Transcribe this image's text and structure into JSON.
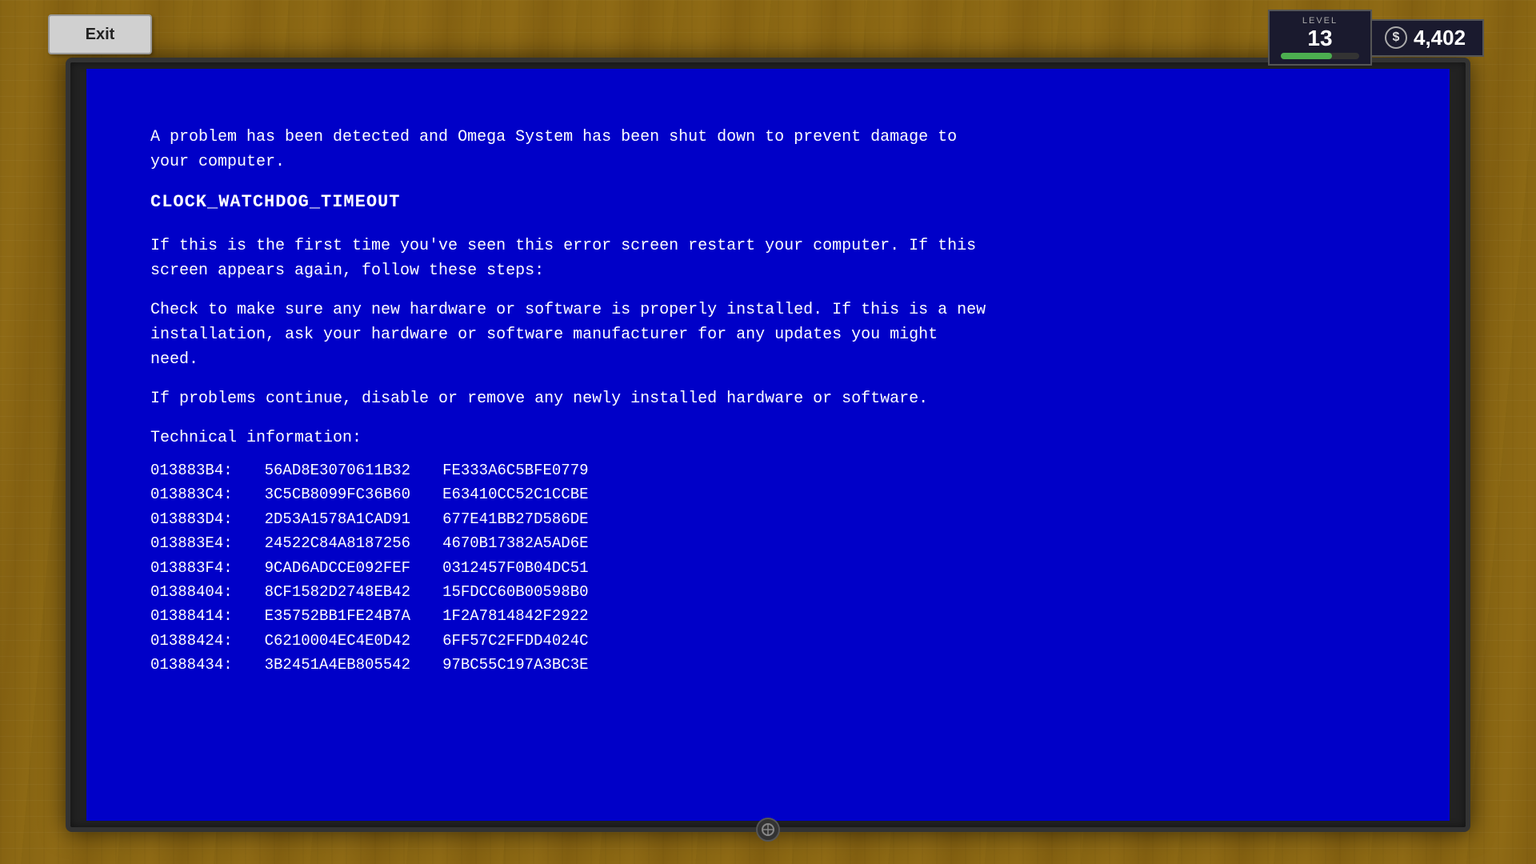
{
  "exitButton": {
    "label": "Exit"
  },
  "hud": {
    "levelLabel": "LEVEL",
    "levelNumber": "13",
    "levelProgress": 65,
    "dollarSign": "$",
    "moneyAmount": "4,402"
  },
  "bsod": {
    "line1": "A problem has been detected and Omega System has been shut down to prevent damage to\nyour computer.",
    "errorCode": "CLOCK_WATCHDOG_TIMEOUT",
    "line2": "If this is the first time you've seen this error screen restart your computer. If this\nscreen appears again, follow these steps:",
    "line3": "Check to make sure any new hardware or software is properly installed. If this is a new\ninstallation, ask your hardware or software manufacturer for any updates you might\nneed.",
    "line4": "If problems continue, disable or remove any newly installed hardware or software.",
    "techLabel": "Technical information:",
    "hexRows": [
      {
        "addr": "013883B4:",
        "val1": "56AD8E3070611B32",
        "val2": "FE333A6C5BFE0779"
      },
      {
        "addr": "013883C4:",
        "val1": "3C5CB8099FC36B60",
        "val2": "E63410CC52C1CCBE"
      },
      {
        "addr": "013883D4:",
        "val1": "2D53A1578A1CAD91",
        "val2": "677E41BB27D586DE"
      },
      {
        "addr": "013883E4:",
        "val1": "24522C84A8187256",
        "val2": "4670B17382A5AD6E"
      },
      {
        "addr": "013883F4:",
        "val1": "9CAD6ADCCE092FEF",
        "val2": "0312457F0B04DC51"
      },
      {
        "addr": "01388404:",
        "val1": "8CF1582D2748EB42",
        "val2": "15FDCC60B00598B0"
      },
      {
        "addr": "01388414:",
        "val1": "E35752BB1FE24B7A",
        "val2": "1F2A7814842F2922"
      },
      {
        "addr": "01388424:",
        "val1": "C6210004EC4E0D42",
        "val2": "6FF57C2FFDD4024C"
      },
      {
        "addr": "01388434:",
        "val1": "3B2451A4EB805542",
        "val2": "97BC55C197A3BC3E"
      }
    ]
  }
}
